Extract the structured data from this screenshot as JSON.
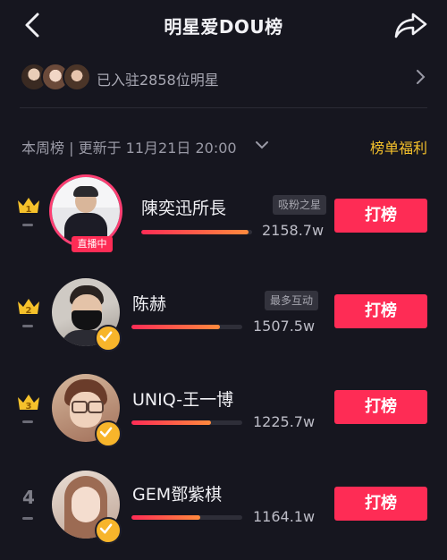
{
  "header": {
    "title": "明星爱DOU榜",
    "back_icon": "chevron-left-icon",
    "share_icon": "share-arrow-icon"
  },
  "stars_summary": {
    "text": "已入驻2858位明星",
    "avatar_count": 3
  },
  "filter": {
    "text": "本周榜 | 更新于 11月21日 20:00",
    "welfare_label": "榜单福利",
    "welfare_color": "#f5c12b"
  },
  "rankings": [
    {
      "rank": "1",
      "name": "陳奕迅所長",
      "tag": "吸粉之星",
      "score": "2158.7w",
      "progress": 0.97,
      "live_badge": "直播中",
      "vote_label": "打榜"
    },
    {
      "rank": "2",
      "name": "陈赫",
      "tag": "最多互动",
      "score": "1507.5w",
      "progress": 0.8,
      "vote_label": "打榜"
    },
    {
      "rank": "3",
      "name": "UNIQ-王一博",
      "tag": "",
      "score": "1225.7w",
      "progress": 0.72,
      "vote_label": "打榜"
    },
    {
      "rank": "4",
      "name": "GEM鄧紫棋",
      "tag": "",
      "score": "1164.1w",
      "progress": 0.62,
      "vote_label": "打榜"
    }
  ],
  "colors": {
    "accent": "#fe2c55",
    "background": "#16161f",
    "crown": "#f5c12b"
  }
}
